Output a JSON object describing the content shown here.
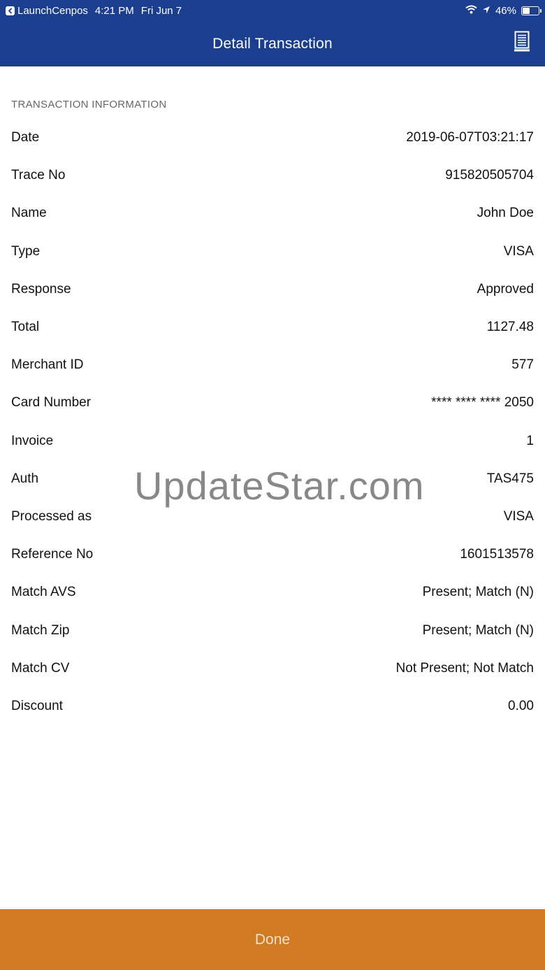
{
  "status_bar": {
    "app_name": "LaunchCenpos",
    "time": "4:21 PM",
    "date": "Fri Jun 7",
    "battery_percent": "46%",
    "battery_level": 0.46
  },
  "nav": {
    "title": "Detail Transaction",
    "right_icon": "receipt-icon"
  },
  "section": {
    "header": "TRANSACTION INFORMATION"
  },
  "rows": [
    {
      "label": "Date",
      "value": "2019-06-07T03:21:17"
    },
    {
      "label": "Trace No",
      "value": "915820505704"
    },
    {
      "label": "Name",
      "value": "John Doe"
    },
    {
      "label": "Type",
      "value": "VISA"
    },
    {
      "label": "Response",
      "value": "Approved"
    },
    {
      "label": "Total",
      "value": "1127.48"
    },
    {
      "label": "Merchant ID",
      "value": "577"
    },
    {
      "label": "Card Number",
      "value": "**** **** **** 2050"
    },
    {
      "label": "Invoice",
      "value": "1"
    },
    {
      "label": "Auth",
      "value": "TAS475"
    },
    {
      "label": "Processed as",
      "value": "VISA"
    },
    {
      "label": "Reference No",
      "value": "1601513578"
    },
    {
      "label": "Match AVS",
      "value": "Present; Match (N)"
    },
    {
      "label": "Match Zip",
      "value": "Present; Match (N)"
    },
    {
      "label": "Match CV",
      "value": "Not Present; Not Match"
    },
    {
      "label": "Discount",
      "value": "0.00"
    }
  ],
  "watermark": "UpdateStar.com",
  "footer": {
    "done_label": "Done"
  },
  "colors": {
    "nav_background": "#1b3f8e",
    "done_background": "#d07a22"
  }
}
